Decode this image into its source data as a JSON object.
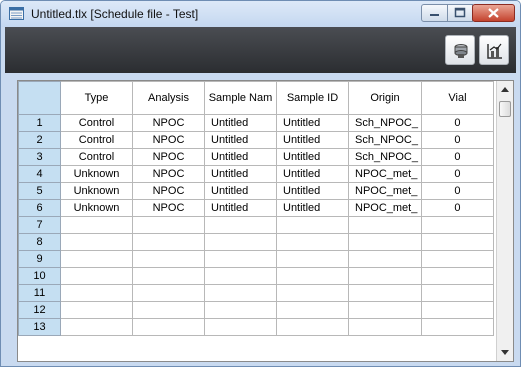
{
  "window": {
    "title": "Untitled.tlx  [Schedule file - Test]"
  },
  "icons": {
    "app": "schedule-file-icon",
    "minimize": "minimize-icon",
    "maximize": "maximize-icon",
    "close": "close-icon",
    "toolbar_1": "sample-tray-icon",
    "toolbar_2": "chart-icon"
  },
  "colors": {
    "row_header": "#c5dff2",
    "close_button": "#c4432e",
    "toolbar": "#2b2d31"
  },
  "table": {
    "columns": [
      "Type",
      "Analysis",
      "Sample Nam",
      "Sample ID",
      "Origin",
      "Vial"
    ],
    "row_numbers": [
      "1",
      "2",
      "3",
      "4",
      "5",
      "6",
      "7",
      "8",
      "9",
      "10",
      "11",
      "12",
      "13"
    ],
    "rows": [
      [
        "Control",
        "NPOC",
        "Untitled",
        "Untitled",
        "Sch_NPOC_",
        "0"
      ],
      [
        "Control",
        "NPOC",
        "Untitled",
        "Untitled",
        "Sch_NPOC_",
        "0"
      ],
      [
        "Control",
        "NPOC",
        "Untitled",
        "Untitled",
        "Sch_NPOC_",
        "0"
      ],
      [
        "Unknown",
        "NPOC",
        "Untitled",
        "Untitled",
        "NPOC_met_",
        "0"
      ],
      [
        "Unknown",
        "NPOC",
        "Untitled",
        "Untitled",
        "NPOC_met_",
        "0"
      ],
      [
        "Unknown",
        "NPOC",
        "Untitled",
        "Untitled",
        "NPOC_met_",
        "0"
      ],
      [
        "",
        "",
        "",
        "",
        "",
        ""
      ],
      [
        "",
        "",
        "",
        "",
        "",
        ""
      ],
      [
        "",
        "",
        "",
        "",
        "",
        ""
      ],
      [
        "",
        "",
        "",
        "",
        "",
        ""
      ],
      [
        "",
        "",
        "",
        "",
        "",
        ""
      ],
      [
        "",
        "",
        "",
        "",
        "",
        ""
      ],
      [
        "",
        "",
        "",
        "",
        "",
        ""
      ]
    ]
  }
}
